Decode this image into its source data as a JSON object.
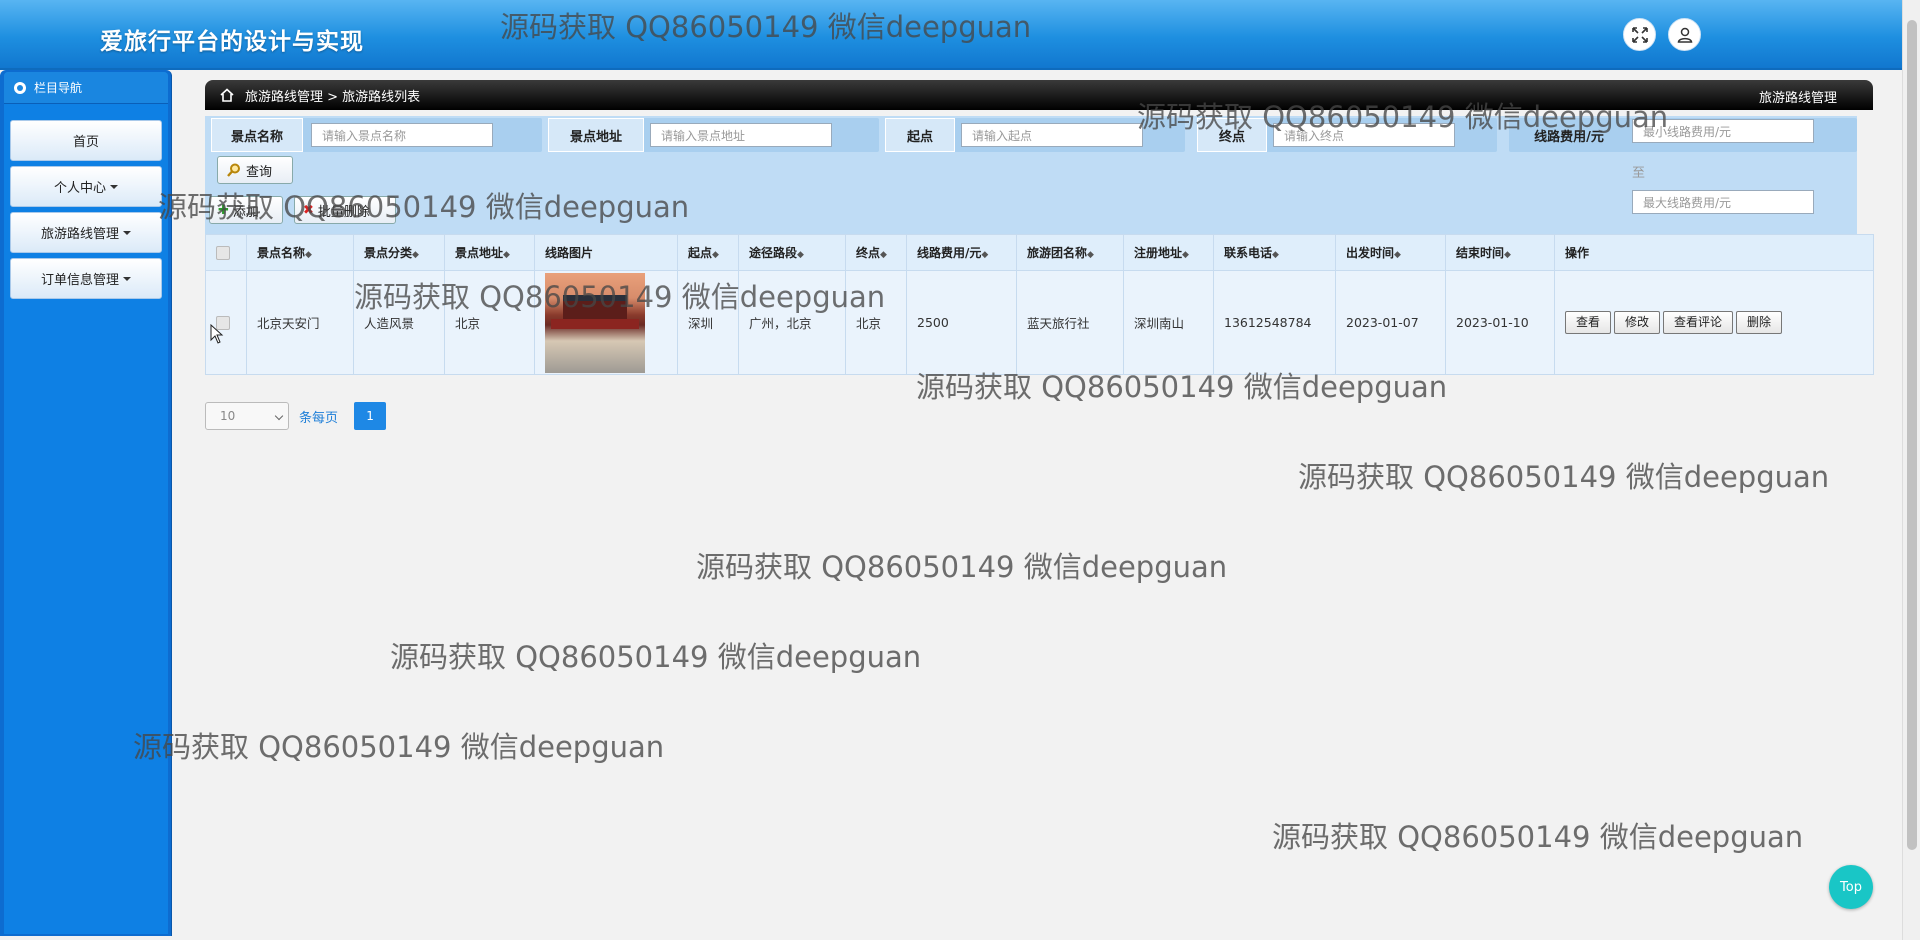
{
  "header": {
    "title": "爱旅行平台的设计与实现"
  },
  "sidebar": {
    "heading": "栏目导航",
    "items": [
      {
        "label": "首页",
        "dropdown": false
      },
      {
        "label": "个人中心",
        "dropdown": true
      },
      {
        "label": "旅游路线管理",
        "dropdown": true
      },
      {
        "label": "订单信息管理",
        "dropdown": true
      }
    ]
  },
  "breadcrumb": {
    "text": "旅游路线管理 > 旅游路线列表",
    "right": "旅游路线管理"
  },
  "search": {
    "f1": {
      "label": "景点名称",
      "placeholder": "请输入景点名称"
    },
    "f2": {
      "label": "景点地址",
      "placeholder": "请输入景点地址"
    },
    "f3": {
      "label": "起点",
      "placeholder": "请输入起点"
    },
    "f4": {
      "label": "终点",
      "placeholder": "请输入终点"
    },
    "f5": {
      "label": "线路费用/元",
      "placeholder_min": "最小线路费用/元",
      "to": "至",
      "placeholder_max": "最大线路费用/元"
    },
    "query_label": "查询"
  },
  "actions": {
    "add_label": "添加",
    "batch_delete_label": "批量删除"
  },
  "table": {
    "headers": [
      "景点名称",
      "景点分类",
      "景点地址",
      "线路图片",
      "起点",
      "途径路段",
      "终点",
      "线路费用/元",
      "旅游团名称",
      "注册地址",
      "联系电话",
      "出发时间",
      "结束时间",
      "操作"
    ],
    "rows": [
      {
        "name": "北京天安门",
        "category": "人造风景",
        "address": "北京",
        "start": "深圳",
        "route": "广州，北京",
        "end": "北京",
        "cost": "2500",
        "group": "蓝天旅行社",
        "reg_address": "深圳南山",
        "phone": "13612548784",
        "depart": "2023-01-07",
        "finish": "2023-01-10",
        "ops": [
          "查看",
          "修改",
          "查看评论",
          "删除"
        ]
      }
    ]
  },
  "pager": {
    "page_size": "10",
    "per_page_label": "条每页",
    "current_page": "1"
  },
  "top_button": "Top",
  "watermark": "源码获取 QQ86050149 微信deepguan"
}
